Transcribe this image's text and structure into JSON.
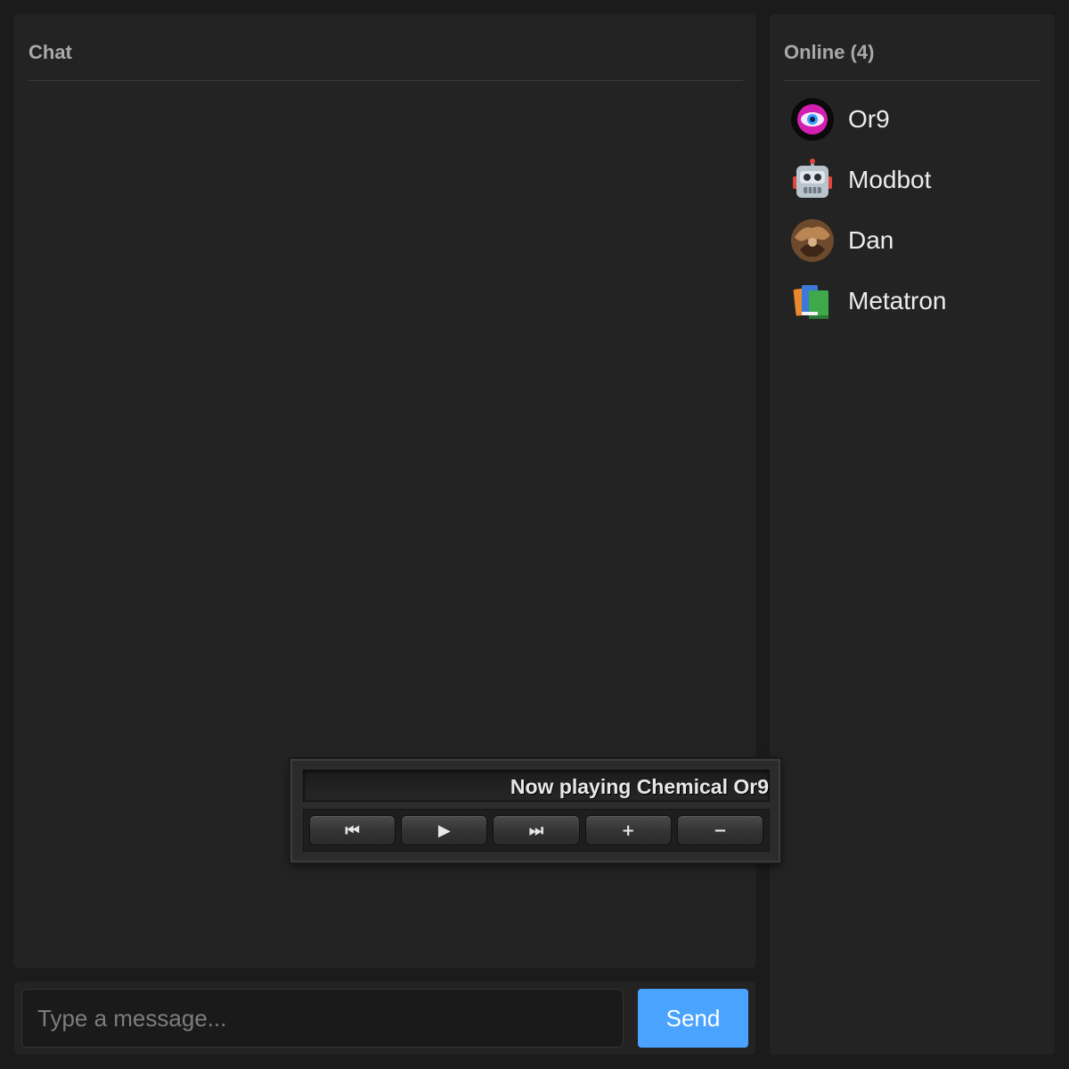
{
  "chat": {
    "title": "Chat",
    "messages": []
  },
  "composer": {
    "placeholder": "Type a message...",
    "send_label": "Send",
    "send_color": "#4aa3ff"
  },
  "online": {
    "title": "Online (4)",
    "users": [
      {
        "name": "Or9",
        "avatar": "eye-avatar"
      },
      {
        "name": "Modbot",
        "avatar": "robot-avatar"
      },
      {
        "name": "Dan",
        "avatar": "photo-avatar"
      },
      {
        "name": "Metatron",
        "avatar": "books-avatar"
      }
    ]
  },
  "player": {
    "now_playing": "Now playing Chemical Or9",
    "buttons": {
      "prev": "⏮",
      "play": "▶",
      "next": "⏭",
      "volume_up": "+",
      "volume_down": "−"
    }
  }
}
